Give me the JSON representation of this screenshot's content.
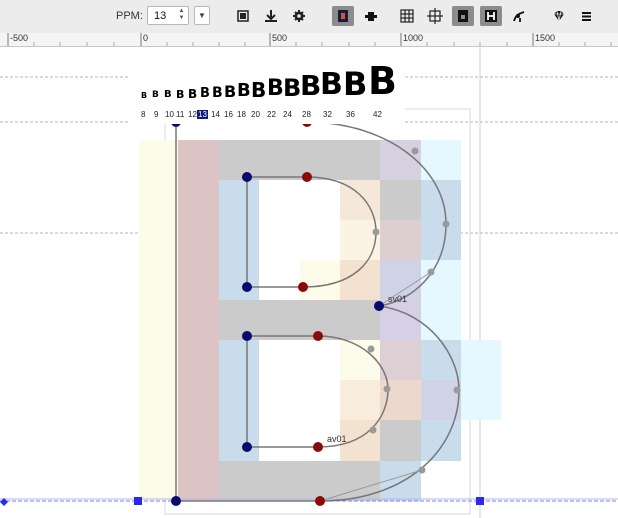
{
  "toolbar": {
    "ppm_label": "PPM:",
    "ppm_value": "13",
    "stepper_up": "▲",
    "stepper_down": "▼",
    "dropdown_arrow": "▼",
    "icons": [
      "preview-icon",
      "hinting-icon",
      "settings-icon",
      "outline-fill-icon",
      "contour-add-icon",
      "grid-icon",
      "anchor-grid-icon",
      "blackfill-icon",
      "hinted-icon",
      "curve-tool-icon",
      "glyph-icon",
      "menu-icon"
    ]
  },
  "ruler": {
    "labels": [
      "-500",
      "0",
      "500",
      "1000",
      "1500"
    ]
  },
  "waterfall": {
    "glyph": "B",
    "sizes": [
      "8",
      "9",
      "10",
      "11",
      "12",
      "13",
      "14",
      "16",
      "18",
      "20",
      "22",
      "24",
      "28",
      "32",
      "36",
      "42"
    ],
    "selected_size": "13"
  },
  "points": {
    "label_sv": "sv01",
    "label_av": "av01"
  },
  "colors": {
    "on_curve_point": "#0a0a6e",
    "off_curve_point": "#8a0a0a",
    "control_point": "#9a9a9a",
    "outline": "#777777",
    "pixel_gray": "#c8c8c8",
    "pixel_red": "#ddc4c4",
    "pixel_blue": "#c9dcec",
    "pixel_yellow": "#fdfce8",
    "pixel_cyan": "#e6f8ff",
    "selection_handle": "#2a2aee"
  }
}
